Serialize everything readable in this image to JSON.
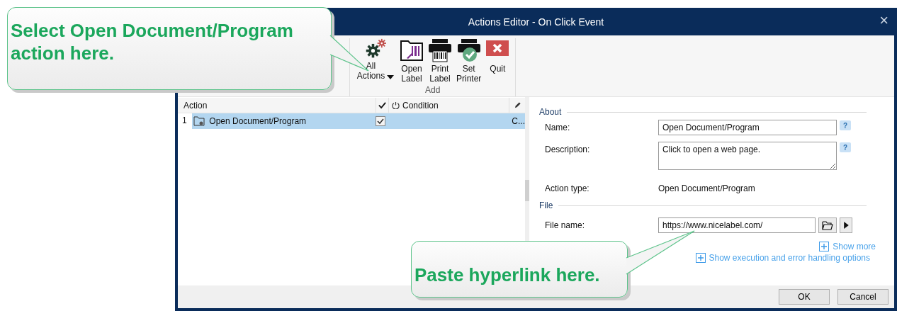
{
  "window": {
    "title": "Actions Editor - On Click Event",
    "close": "×"
  },
  "ribbon": {
    "add_group": {
      "label": "Add",
      "buttons": [
        {
          "kind": "all_actions",
          "lines": [
            "All",
            "Actions"
          ],
          "dropdown": true
        },
        {
          "kind": "open_label",
          "lines": [
            "Open",
            "Label"
          ],
          "dropdown": false
        },
        {
          "kind": "print_label",
          "lines": [
            "Print",
            "Label"
          ],
          "dropdown": false
        },
        {
          "kind": "set_printer",
          "lines": [
            "Set",
            "Printer"
          ],
          "dropdown": false
        },
        {
          "kind": "quit",
          "lines": [
            "Quit"
          ],
          "dropdown": false
        }
      ]
    }
  },
  "actions_table": {
    "columns": [
      "Action",
      "Condition"
    ],
    "rows": [
      {
        "number": "1",
        "name": "Open Document/Program",
        "enabled": true,
        "column_4": "C...",
        "selected": true
      }
    ]
  },
  "properties": {
    "sections": [
      {
        "title": "About",
        "fields": [
          {
            "kind": "input",
            "label": "Name:",
            "value": "Open Document/Program",
            "help": "?"
          },
          {
            "kind": "textarea",
            "label": "Description:",
            "value": "Click to open a web page.",
            "help": "?"
          },
          {
            "kind": "text",
            "label": "Action type:",
            "value": "Open Document/Program"
          }
        ]
      },
      {
        "title": "File",
        "fields": [
          {
            "kind": "file",
            "label": "File name:",
            "value": "https://www.nicelabel.com/"
          }
        ]
      }
    ],
    "links": [
      {
        "label": "Show more"
      },
      {
        "label": "Show execution and error handling options"
      }
    ]
  },
  "footer_buttons": [
    "OK",
    "Cancel"
  ],
  "callouts": [
    {
      "text": "Select Open Document/Program action here."
    },
    {
      "text": "Paste hyperlink here."
    }
  ]
}
